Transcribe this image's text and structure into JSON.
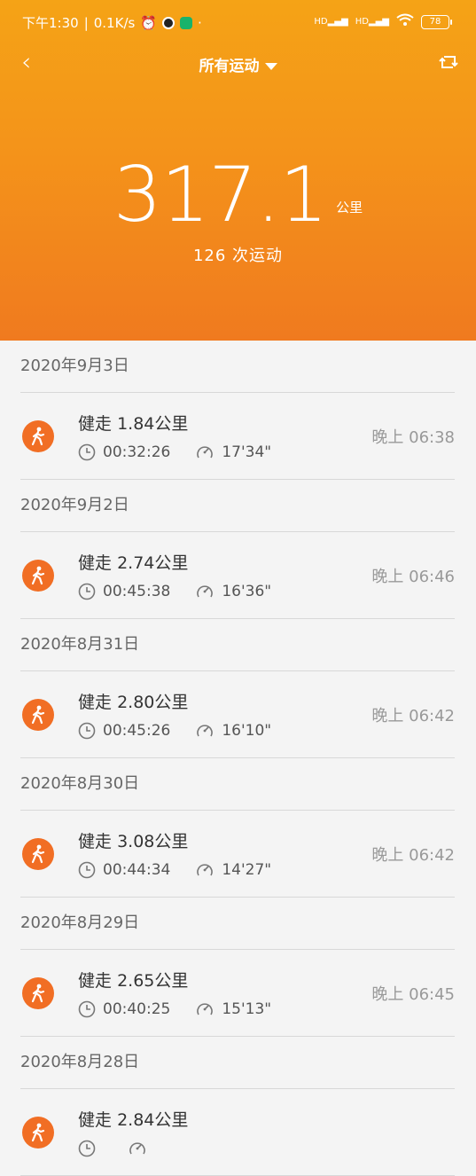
{
  "status_bar": {
    "time": "下午1:30",
    "network_speed": "0.1K/s",
    "battery": "78",
    "signal1": "HD",
    "signal2": "HD"
  },
  "nav": {
    "title": "所有运动"
  },
  "summary": {
    "total_distance": "317.1",
    "unit": "公里",
    "count_text": "126 次运动"
  },
  "groups": [
    {
      "date": "2020年9月3日",
      "record": {
        "type": "健走",
        "distance": "1.84公里",
        "duration": "00:32:26",
        "pace": "17'34\"",
        "time": "晚上 06:38"
      }
    },
    {
      "date": "2020年9月2日",
      "record": {
        "type": "健走",
        "distance": "2.74公里",
        "duration": "00:45:38",
        "pace": "16'36\"",
        "time": "晚上 06:46"
      }
    },
    {
      "date": "2020年8月31日",
      "record": {
        "type": "健走",
        "distance": "2.80公里",
        "duration": "00:45:26",
        "pace": "16'10\"",
        "time": "晚上 06:42"
      }
    },
    {
      "date": "2020年8月30日",
      "record": {
        "type": "健走",
        "distance": "3.08公里",
        "duration": "00:44:34",
        "pace": "14'27\"",
        "time": "晚上 06:42"
      }
    },
    {
      "date": "2020年8月29日",
      "record": {
        "type": "健走",
        "distance": "2.65公里",
        "duration": "00:40:25",
        "pace": "15'13\"",
        "time": "晚上 06:45"
      }
    },
    {
      "date": "2020年8月28日",
      "record": {
        "type": "健走",
        "distance": "2.84公里",
        "duration": "",
        "pace": "",
        "time": ""
      }
    }
  ]
}
